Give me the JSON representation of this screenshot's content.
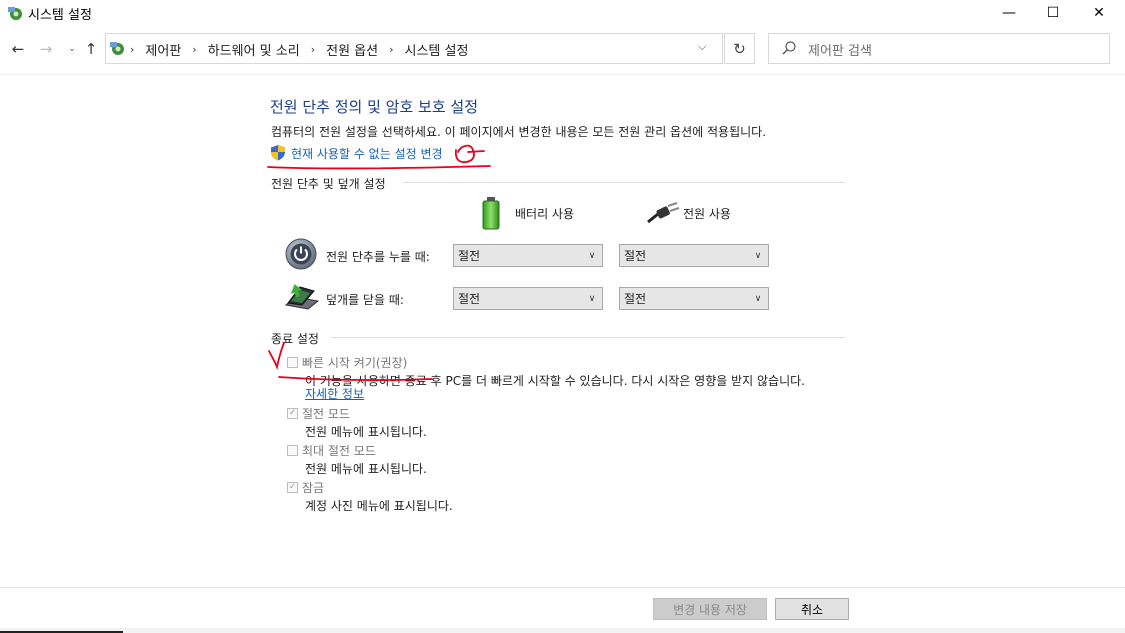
{
  "window": {
    "title": "시스템 설정",
    "controls": {
      "minimize": "—",
      "maximize": "☐",
      "close": "✕"
    }
  },
  "addressbar": {
    "breadcrumbs": [
      "제어판",
      "하드웨어 및 소리",
      "전원 옵션",
      "시스템 설정"
    ],
    "search_placeholder": "제어판 검색"
  },
  "main": {
    "title": "전원 단추 정의 및 암호 보호 설정",
    "description": "컴퓨터의 전원 설정을 선택하세요. 이 페이지에서 변경한 내용은 모든 전원 관리 옵션에 적용됩니다.",
    "change_link": "현재 사용할 수 없는 설정 변경",
    "power_section": {
      "heading": "전원 단추 및 덮개 설정",
      "col_battery": "배터리 사용",
      "col_plugged": "전원 사용",
      "rows": [
        {
          "label": "전원 단추를 누를 때:",
          "battery": "절전",
          "plugged": "절전"
        },
        {
          "label": "덮개를 닫을 때:",
          "battery": "절전",
          "plugged": "절전"
        }
      ]
    },
    "shutdown_section": {
      "heading": "종료 설정",
      "items": [
        {
          "label": "빠른 시작 켜기(권장)",
          "checked": false,
          "description": "이 기능을 사용하면 종료 후 PC를 더 빠르게 시작할 수 있습니다. 다시 시작은 영향을 받지 않습니다.",
          "link": "자세한 정보"
        },
        {
          "label": "절전 모드",
          "checked": true,
          "description": "전원 메뉴에 표시됩니다."
        },
        {
          "label": "최대 절전 모드",
          "checked": false,
          "description": "전원 메뉴에 표시됩니다."
        },
        {
          "label": "잠금",
          "checked": true,
          "description": "계정 사진 메뉴에 표시됩니다."
        }
      ]
    }
  },
  "footer": {
    "save_label": "변경 내용 저장",
    "cancel_label": "취소"
  },
  "colors": {
    "title_blue": "#1a3e8f",
    "link_blue": "#1562b8",
    "annotation_red": "#e8001c"
  }
}
